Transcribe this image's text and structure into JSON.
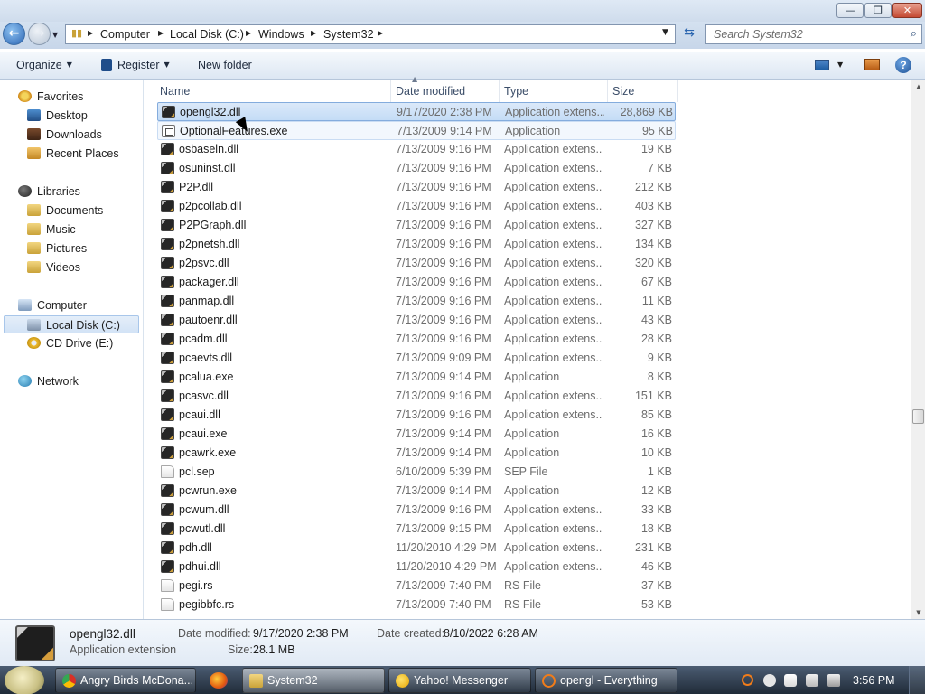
{
  "window": {
    "minimize_glyph": "—",
    "maximize_glyph": "❐",
    "close_glyph": "✕"
  },
  "nav": {
    "back_glyph": "←",
    "forward_glyph": "→"
  },
  "address": {
    "crumbs": [
      "Computer",
      "Local Disk (C:)",
      "Windows",
      "System32"
    ]
  },
  "search": {
    "placeholder": "Search System32"
  },
  "toolbar": {
    "organize": "Organize",
    "register": "Register",
    "new_folder": "New folder"
  },
  "sidebar": {
    "favorites": "Favorites",
    "desktop": "Desktop",
    "downloads": "Downloads",
    "recent_places": "Recent Places",
    "libraries": "Libraries",
    "documents": "Documents",
    "music": "Music",
    "pictures": "Pictures",
    "videos": "Videos",
    "computer": "Computer",
    "local_disk": "Local Disk (C:)",
    "cd_drive": "CD Drive (E:)",
    "network": "Network"
  },
  "columns": {
    "name": "Name",
    "date": "Date modified",
    "type": "Type",
    "size": "Size"
  },
  "files": [
    {
      "name": "opengl32.dll",
      "date": "9/17/2020 2:38 PM",
      "type": "Application extens...",
      "size": "28,869 KB",
      "icon": "dll-icon"
    },
    {
      "name": "OptionalFeatures.exe",
      "date": "7/13/2009 9:14 PM",
      "type": "Application",
      "size": "95 KB",
      "icon": "exe-icon"
    },
    {
      "name": "osbaseln.dll",
      "date": "7/13/2009 9:16 PM",
      "type": "Application extens...",
      "size": "19 KB",
      "icon": "dll-icon"
    },
    {
      "name": "osuninst.dll",
      "date": "7/13/2009 9:16 PM",
      "type": "Application extens...",
      "size": "7 KB",
      "icon": "dll-icon"
    },
    {
      "name": "P2P.dll",
      "date": "7/13/2009 9:16 PM",
      "type": "Application extens...",
      "size": "212 KB",
      "icon": "dll-icon"
    },
    {
      "name": "p2pcollab.dll",
      "date": "7/13/2009 9:16 PM",
      "type": "Application extens...",
      "size": "403 KB",
      "icon": "dll-icon"
    },
    {
      "name": "P2PGraph.dll",
      "date": "7/13/2009 9:16 PM",
      "type": "Application extens...",
      "size": "327 KB",
      "icon": "dll-icon"
    },
    {
      "name": "p2pnetsh.dll",
      "date": "7/13/2009 9:16 PM",
      "type": "Application extens...",
      "size": "134 KB",
      "icon": "dll-icon"
    },
    {
      "name": "p2psvc.dll",
      "date": "7/13/2009 9:16 PM",
      "type": "Application extens...",
      "size": "320 KB",
      "icon": "dll-icon"
    },
    {
      "name": "packager.dll",
      "date": "7/13/2009 9:16 PM",
      "type": "Application extens...",
      "size": "67 KB",
      "icon": "dll-icon"
    },
    {
      "name": "panmap.dll",
      "date": "7/13/2009 9:16 PM",
      "type": "Application extens...",
      "size": "11 KB",
      "icon": "dll-icon"
    },
    {
      "name": "pautoenr.dll",
      "date": "7/13/2009 9:16 PM",
      "type": "Application extens...",
      "size": "43 KB",
      "icon": "dll-icon"
    },
    {
      "name": "pcadm.dll",
      "date": "7/13/2009 9:16 PM",
      "type": "Application extens...",
      "size": "28 KB",
      "icon": "dll-icon"
    },
    {
      "name": "pcaevts.dll",
      "date": "7/13/2009 9:09 PM",
      "type": "Application extens...",
      "size": "9 KB",
      "icon": "dll-icon"
    },
    {
      "name": "pcalua.exe",
      "date": "7/13/2009 9:14 PM",
      "type": "Application",
      "size": "8 KB",
      "icon": "dll-icon"
    },
    {
      "name": "pcasvc.dll",
      "date": "7/13/2009 9:16 PM",
      "type": "Application extens...",
      "size": "151 KB",
      "icon": "dll-icon"
    },
    {
      "name": "pcaui.dll",
      "date": "7/13/2009 9:16 PM",
      "type": "Application extens...",
      "size": "85 KB",
      "icon": "dll-icon"
    },
    {
      "name": "pcaui.exe",
      "date": "7/13/2009 9:14 PM",
      "type": "Application",
      "size": "16 KB",
      "icon": "dll-icon"
    },
    {
      "name": "pcawrk.exe",
      "date": "7/13/2009 9:14 PM",
      "type": "Application",
      "size": "10 KB",
      "icon": "dll-icon"
    },
    {
      "name": "pcl.sep",
      "date": "6/10/2009 5:39 PM",
      "type": "SEP File",
      "size": "1 KB",
      "icon": "file-icon"
    },
    {
      "name": "pcwrun.exe",
      "date": "7/13/2009 9:14 PM",
      "type": "Application",
      "size": "12 KB",
      "icon": "dll-icon"
    },
    {
      "name": "pcwum.dll",
      "date": "7/13/2009 9:16 PM",
      "type": "Application extens...",
      "size": "33 KB",
      "icon": "dll-icon"
    },
    {
      "name": "pcwutl.dll",
      "date": "7/13/2009 9:15 PM",
      "type": "Application extens...",
      "size": "18 KB",
      "icon": "dll-icon"
    },
    {
      "name": "pdh.dll",
      "date": "11/20/2010 4:29 PM",
      "type": "Application extens...",
      "size": "231 KB",
      "icon": "dll-icon"
    },
    {
      "name": "pdhui.dll",
      "date": "11/20/2010 4:29 PM",
      "type": "Application extens...",
      "size": "46 KB",
      "icon": "dll-icon"
    },
    {
      "name": "pegi.rs",
      "date": "7/13/2009 7:40 PM",
      "type": "RS File",
      "size": "37 KB",
      "icon": "file-icon"
    },
    {
      "name": "pegibbfc.rs",
      "date": "7/13/2009 7:40 PM",
      "type": "RS File",
      "size": "53 KB",
      "icon": "file-icon"
    }
  ],
  "details": {
    "name": "opengl32.dll",
    "kind": "Application extension",
    "modified_label": "Date modified:",
    "modified_value": "9/17/2020 2:38 PM",
    "created_label": "Date created:",
    "created_value": "8/10/2022 6:28 AM",
    "size_label": "Size:",
    "size_value": "28.1 MB"
  },
  "taskbar": {
    "items": [
      {
        "label": "Angry Birds McDona...",
        "icon": "chrome-icon"
      },
      {
        "label": "System32",
        "icon": "folder-icon"
      },
      {
        "label": "Yahoo! Messenger",
        "icon": "yahoo-messenger-icon"
      },
      {
        "label": "opengl - Everything",
        "icon": "everything-search-icon"
      }
    ],
    "clock": "3:56 PM"
  },
  "colors": {
    "selection": "#c4dcf6",
    "taskbar": "#202b38"
  }
}
